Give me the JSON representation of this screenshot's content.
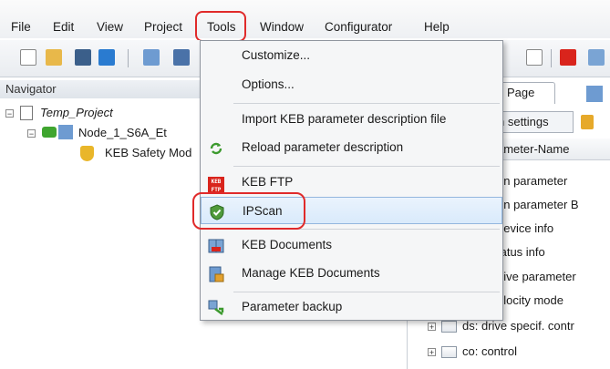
{
  "menubar": {
    "items": [
      {
        "label": "File"
      },
      {
        "label": "Edit"
      },
      {
        "label": "View"
      },
      {
        "label": "Project"
      },
      {
        "label": "Tools"
      },
      {
        "label": "Window"
      },
      {
        "label": "Configurator"
      },
      {
        "label": "Help"
      }
    ]
  },
  "navigator": {
    "title": "Navigator",
    "tree": [
      {
        "label": "Temp_Project"
      },
      {
        "label": "Node_1_S6A_Et"
      },
      {
        "label": "KEB Safety Mod"
      }
    ]
  },
  "right_panel": {
    "tab_label": "Page",
    "settings_label": "n settings",
    "column_header": "ameter-Name",
    "params": [
      "un parameter",
      "un parameter B",
      "device info",
      "tatus info",
      "lrive parameter",
      "elocity mode"
    ],
    "bottom_rows": [
      "ds: drive specif. contr",
      "co: control"
    ]
  },
  "tools_menu": {
    "items": [
      {
        "label": "Customize...",
        "icon": "none"
      },
      {
        "label": "Options...",
        "icon": "none"
      },
      {
        "label": "Import KEB parameter description file",
        "icon": "none"
      },
      {
        "label": "Reload parameter description",
        "icon": "reload-icon"
      },
      {
        "label": "KEB FTP",
        "icon": "keb-ftp-icon",
        "badge_top": "KEB",
        "badge_bottom": "FTP"
      },
      {
        "label": "IPScan",
        "icon": "shield-check-icon",
        "highlighted": true
      },
      {
        "label": "KEB Documents",
        "icon": "keb-documents-icon"
      },
      {
        "label": "Manage KEB Documents",
        "icon": "manage-documents-icon"
      },
      {
        "label": "Parameter backup",
        "icon": "parameter-backup-icon"
      }
    ]
  },
  "colors": {
    "highlight_ring": "#e02a2a",
    "menu_highlight": "#d9eafb",
    "keb_red": "#d9241c"
  }
}
